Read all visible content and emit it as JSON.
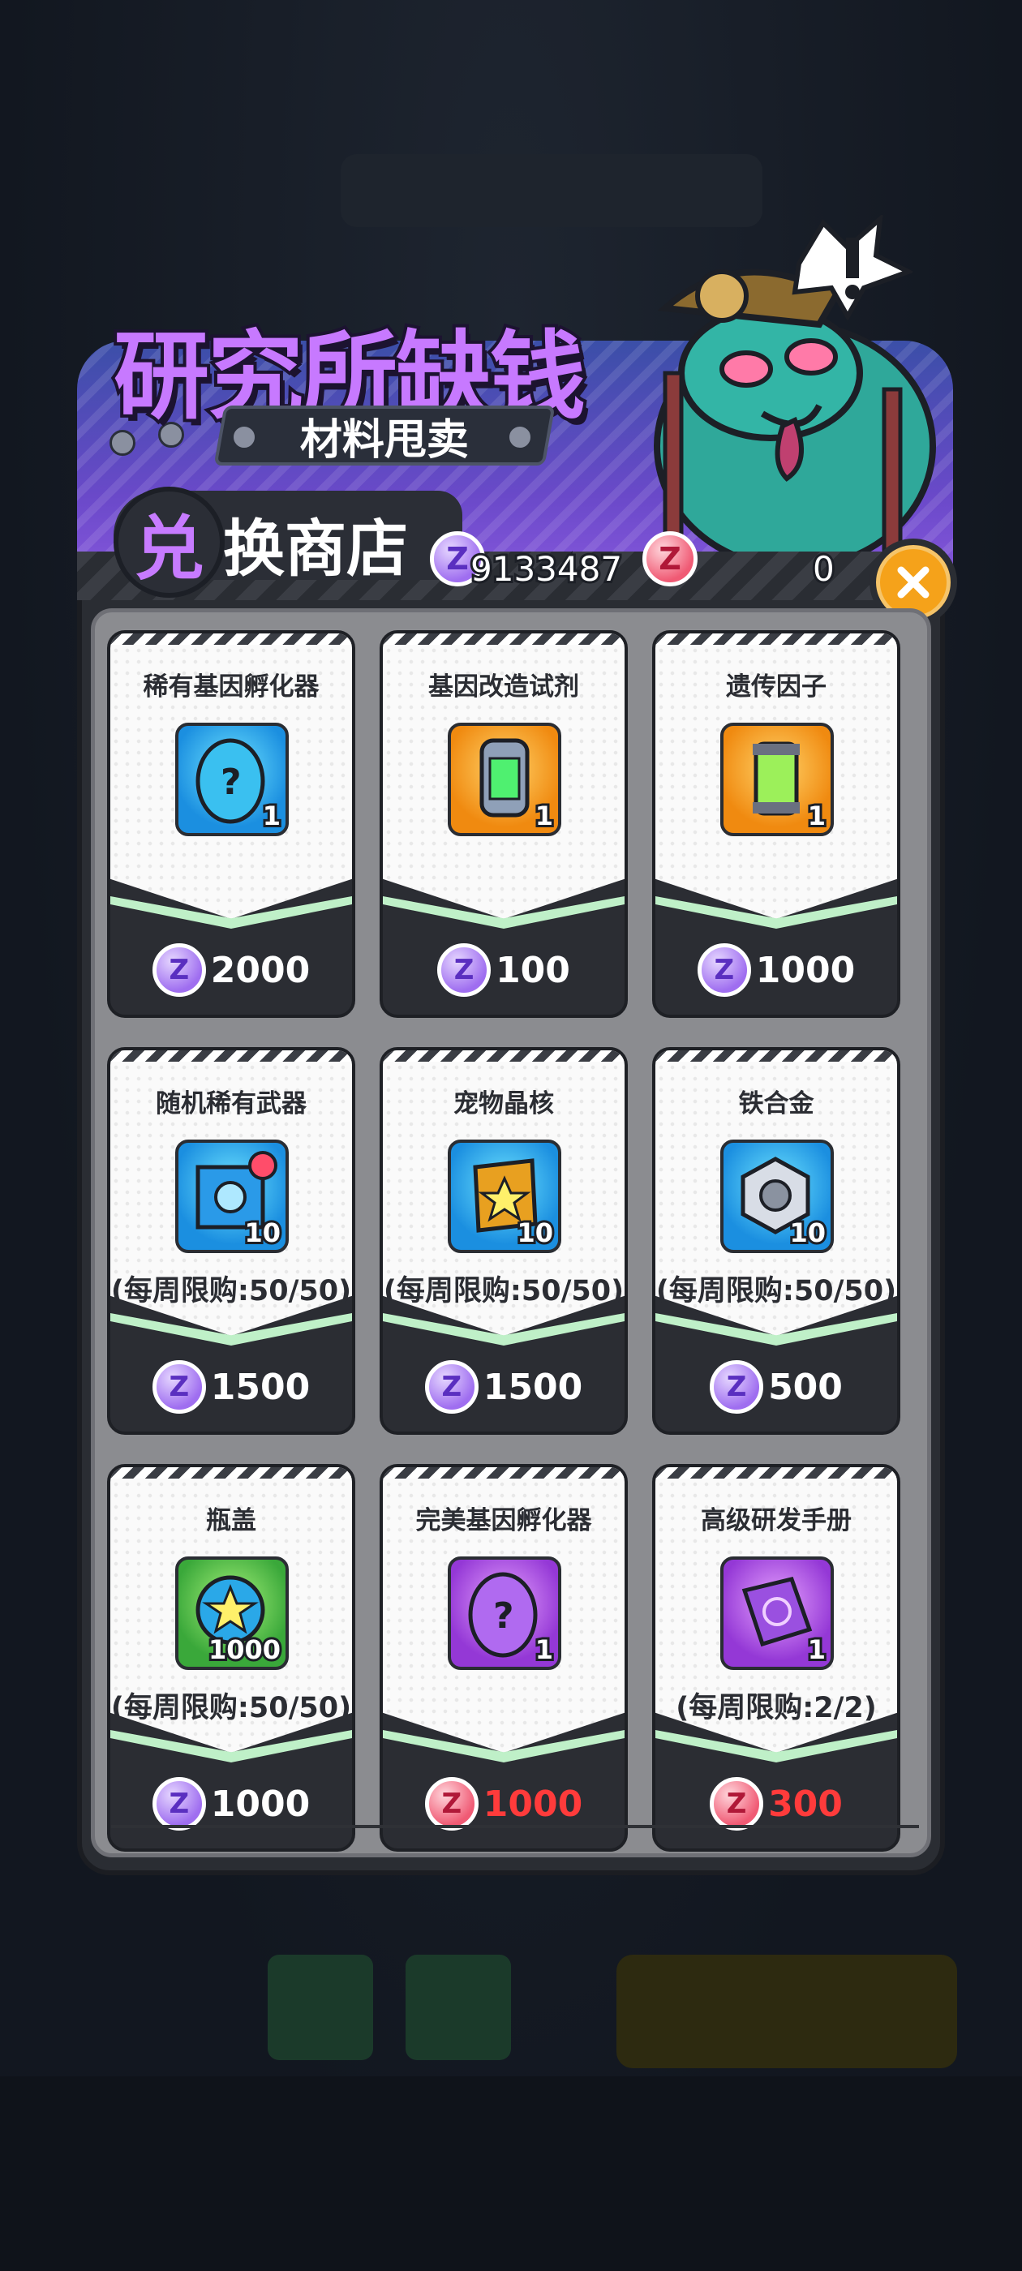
{
  "banner": {
    "title": "研究所缺钱",
    "subtitle": "材料甩卖",
    "shop_badge": "兑",
    "shop_title": "换商店"
  },
  "currency": {
    "purple_icon": "Z",
    "purple_amount": "9133487",
    "red_icon": "Z",
    "red_amount": "0"
  },
  "close_icon": "close-icon",
  "items": [
    {
      "name": "稀有基因孵化器",
      "icon": "blue-egg-icon",
      "qty": "1",
      "limit": "",
      "coin": "purple",
      "price": "2000",
      "price_red": false
    },
    {
      "name": "基因改造试剂",
      "icon": "green-canister-icon",
      "qty": "1",
      "limit": "",
      "coin": "purple",
      "price": "100",
      "price_red": false
    },
    {
      "name": "遗传因子",
      "icon": "green-tube-icon",
      "qty": "1",
      "limit": "",
      "coin": "purple",
      "price": "1000",
      "price_red": false
    },
    {
      "name": "随机稀有武器",
      "icon": "weapon-box-icon",
      "qty": "10",
      "limit": "(每周限购:50/50)",
      "coin": "purple",
      "price": "1500",
      "price_red": false
    },
    {
      "name": "宠物晶核",
      "icon": "star-crystal-icon",
      "qty": "10",
      "limit": "(每周限购:50/50)",
      "coin": "purple",
      "price": "1500",
      "price_red": false
    },
    {
      "name": "铁合金",
      "icon": "hex-nut-icon",
      "qty": "10",
      "limit": "(每周限购:50/50)",
      "coin": "purple",
      "price": "500",
      "price_red": false
    },
    {
      "name": "瓶盖",
      "icon": "bottle-cap-icon",
      "qty": "1000",
      "limit": "(每周限购:50/50)",
      "coin": "purple",
      "price": "1000",
      "price_red": false
    },
    {
      "name": "完美基因孵化器",
      "icon": "purple-egg-icon",
      "qty": "1",
      "limit": "",
      "coin": "red",
      "price": "1000",
      "price_red": true
    },
    {
      "name": "高级研发手册",
      "icon": "research-book-icon",
      "qty": "1",
      "limit": "(每周限购:2/2)",
      "coin": "red",
      "price": "300",
      "price_red": true
    }
  ],
  "colors": {
    "accent_purple": "#c779ff",
    "close_orange": "#f5a21a",
    "price_red": "#ff3b3b"
  }
}
